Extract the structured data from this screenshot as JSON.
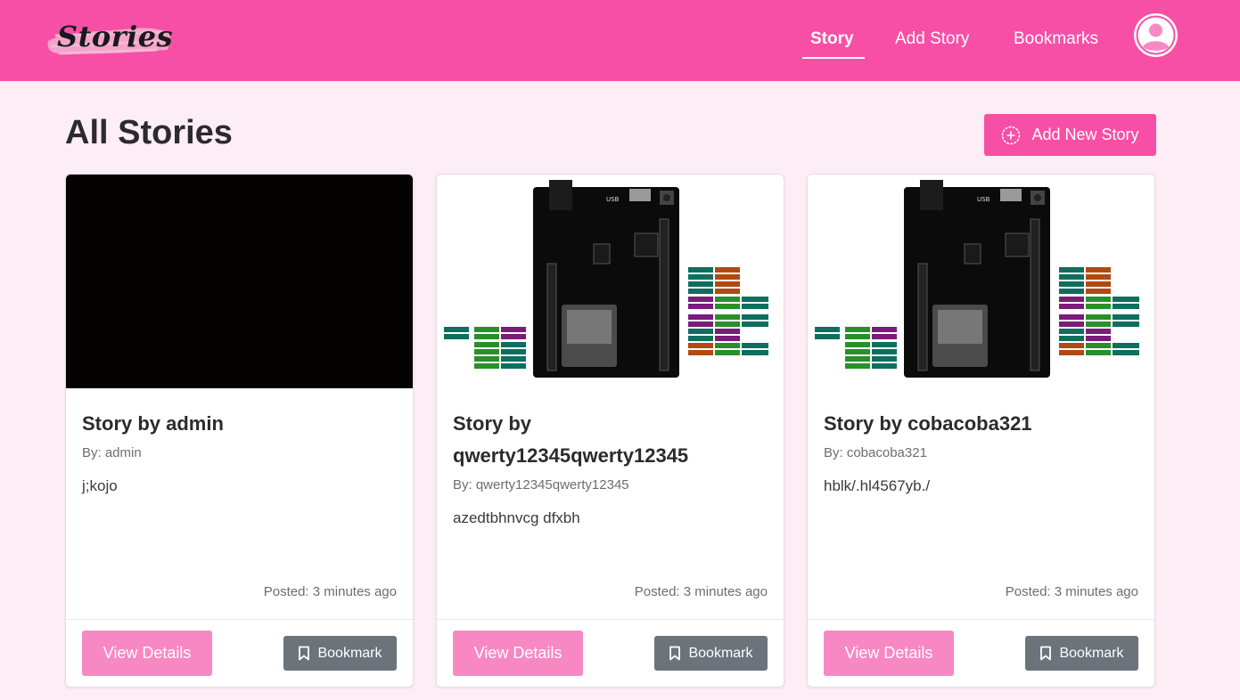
{
  "header": {
    "logo_text": "Stories",
    "nav": [
      {
        "label": "Story",
        "active": true
      },
      {
        "label": "Add Story",
        "active": false
      },
      {
        "label": "Bookmarks",
        "active": false
      }
    ],
    "avatar_icon": "user-avatar-icon"
  },
  "main": {
    "title": "All Stories",
    "add_button_label": "Add New Story"
  },
  "stories": [
    {
      "title": "Story by admin",
      "author": "By: admin",
      "description": "j;kojo",
      "posted": "Posted: 3 minutes ago",
      "image": "dark",
      "view_label": "View Details",
      "bookmark_label": "Bookmark"
    },
    {
      "title": "Story by qwerty12345qwerty12345",
      "author": "By: qwerty12345qwerty12345",
      "description": "azedtbhnvcg dfxbh",
      "posted": "Posted: 3 minutes ago",
      "image": "board",
      "view_label": "View Details",
      "bookmark_label": "Bookmark"
    },
    {
      "title": "Story by cobacoba321",
      "author": "By: cobacoba321",
      "description": "hblk/.hl4567yb./",
      "posted": "Posted: 3 minutes ago",
      "image": "board",
      "view_label": "View Details",
      "bookmark_label": "Bookmark"
    }
  ],
  "colors": {
    "brand": "#f84fa6",
    "page_bg": "#fdeef5",
    "view_btn": "#f888c4",
    "bookmark_btn": "#6c737b"
  }
}
